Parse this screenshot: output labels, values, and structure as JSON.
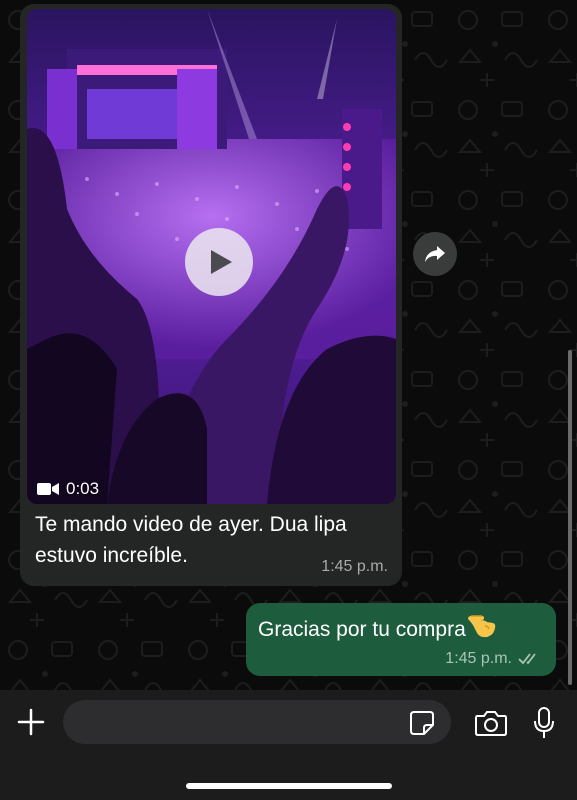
{
  "chat": {
    "incoming": {
      "video_duration": "0:03",
      "caption": "Te mando video de ayer. Dua lipa estuvo increíble.",
      "time": "1:45 p.m."
    },
    "outgoing": {
      "text": "Gracias por tu compra",
      "time": "1:45 p.m.",
      "status": "delivered"
    }
  },
  "icons": {
    "play": "play-icon",
    "video_camera": "video-camera-icon",
    "forward": "forward-icon",
    "hand_emoji": "pointing-hand-emoji",
    "double_check": "double-check-icon",
    "plus": "plus-icon",
    "sticker": "sticker-icon",
    "camera": "camera-icon",
    "mic": "microphone-icon"
  },
  "colors": {
    "incoming_bubble": "#242626",
    "outgoing_bubble": "#1d5d3e",
    "background": "#0b0b0b",
    "input_bar": "#1c1c1c"
  }
}
